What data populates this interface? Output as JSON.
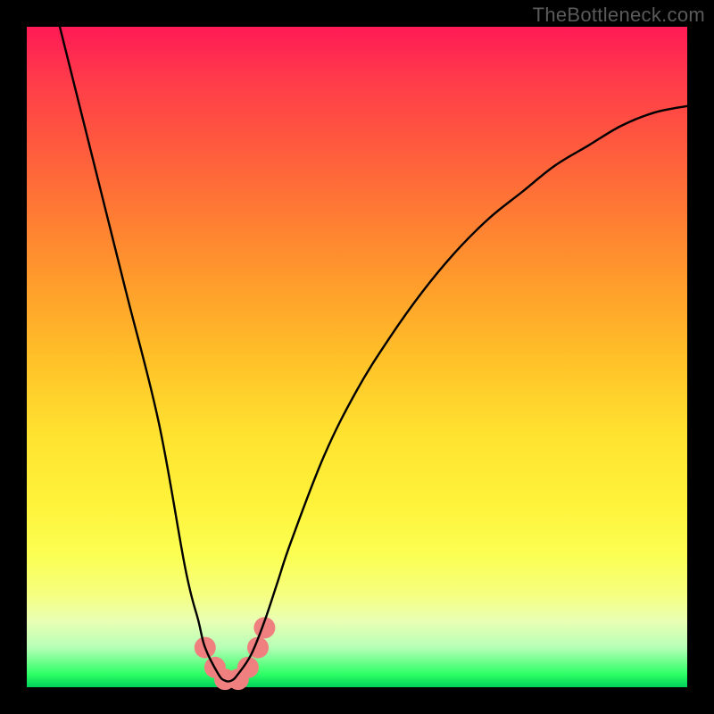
{
  "watermark": "TheBottleneck.com",
  "chart_data": {
    "type": "line",
    "title": "",
    "xlabel": "",
    "ylabel": "",
    "xlim": [
      0,
      100
    ],
    "ylim": [
      0,
      100
    ],
    "series": [
      {
        "name": "bottleneck-curve",
        "x": [
          5,
          10,
          15,
          20,
          24,
          26,
          27,
          29,
          30,
          31,
          32,
          34,
          36,
          38,
          40,
          45,
          50,
          55,
          60,
          65,
          70,
          75,
          80,
          85,
          90,
          95,
          100
        ],
        "values": [
          100,
          80,
          60,
          40,
          18,
          10,
          6,
          2,
          1,
          1,
          2,
          5,
          10,
          16,
          22,
          35,
          45,
          53,
          60,
          66,
          71,
          75,
          79,
          82,
          85,
          87,
          88
        ]
      }
    ],
    "markers": {
      "name": "highlight-dots",
      "x": [
        27,
        28.5,
        30,
        32,
        33.5,
        35,
        36
      ],
      "values": [
        6,
        3,
        1.2,
        1.2,
        3,
        6,
        9
      ],
      "color": "#f08080",
      "radius": 12
    },
    "gradient_stops": [
      {
        "pos": 0,
        "color": "#ff1a55"
      },
      {
        "pos": 50,
        "color": "#ffc028"
      },
      {
        "pos": 80,
        "color": "#fbff52"
      },
      {
        "pos": 100,
        "color": "#00d05a"
      }
    ]
  }
}
